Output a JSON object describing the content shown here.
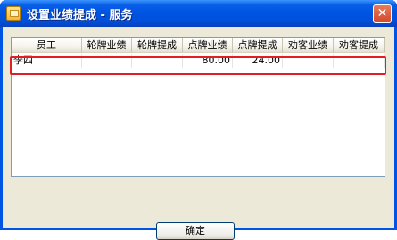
{
  "window": {
    "title": "设置业绩提成 - 服务",
    "close_glyph": "✕"
  },
  "table": {
    "columns": [
      "员工",
      "轮牌业绩",
      "轮牌提成",
      "点牌业绩",
      "点牌提成",
      "劝客业绩",
      "劝客提成"
    ],
    "rows": [
      [
        "李四",
        "",
        "",
        "80.00",
        "24.00",
        "",
        ""
      ]
    ]
  },
  "buttons": {
    "ok_label": "确定"
  },
  "colors": {
    "title_bar": "#0054e3",
    "highlight_border": "#e02020"
  },
  "icons": {
    "app": "app-icon",
    "close": "close-icon"
  }
}
